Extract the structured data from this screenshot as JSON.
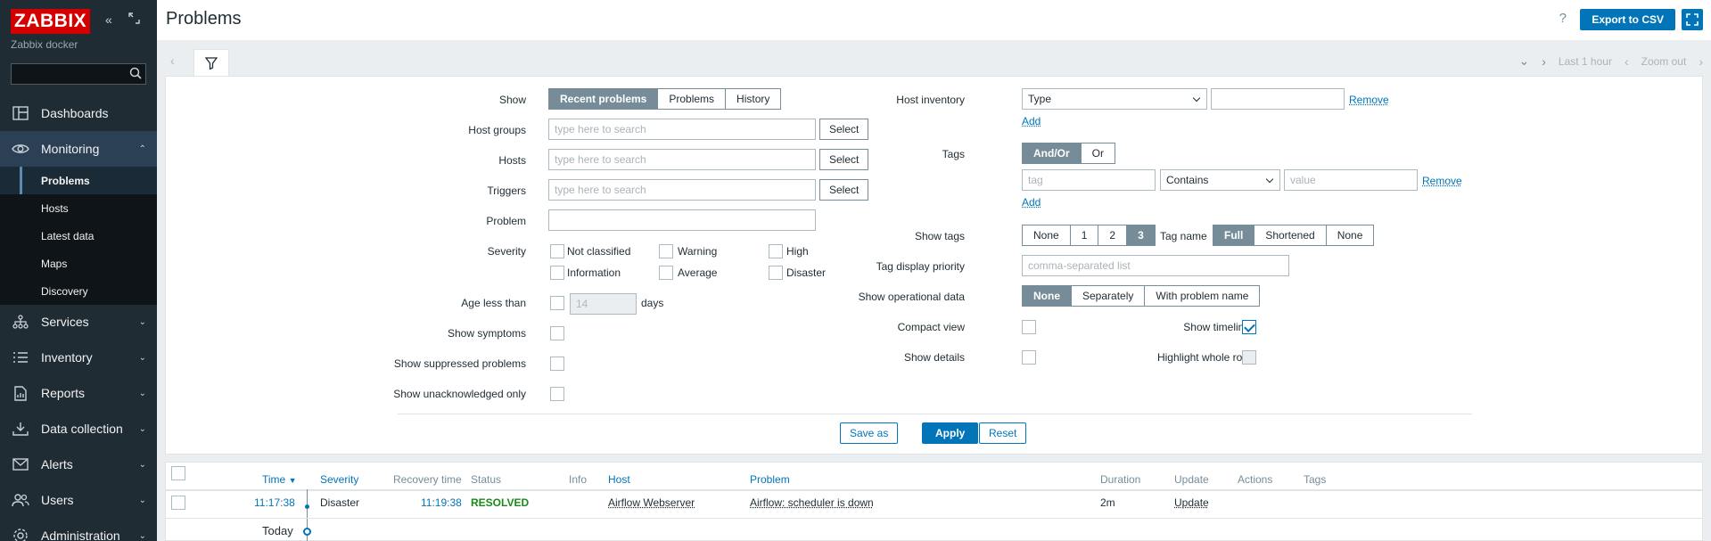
{
  "sidebar": {
    "logo": "ZABBIX",
    "subtitle": "Zabbix docker",
    "search_placeholder": "",
    "nav": [
      {
        "label": "Dashboards",
        "icon": "dashboards-icon"
      },
      {
        "label": "Monitoring",
        "icon": "eye-icon"
      },
      {
        "label": "Services",
        "icon": "services-icon"
      },
      {
        "label": "Inventory",
        "icon": "list-icon"
      },
      {
        "label": "Reports",
        "icon": "reports-icon"
      },
      {
        "label": "Data collection",
        "icon": "download-icon"
      },
      {
        "label": "Alerts",
        "icon": "mail-icon"
      },
      {
        "label": "Users",
        "icon": "users-icon"
      },
      {
        "label": "Administration",
        "icon": "gear-icon"
      }
    ],
    "monitoring_sub": [
      {
        "label": "Problems"
      },
      {
        "label": "Hosts"
      },
      {
        "label": "Latest data"
      },
      {
        "label": "Maps"
      },
      {
        "label": "Discovery"
      }
    ]
  },
  "header": {
    "title": "Problems",
    "help": "?",
    "export": "Export to CSV"
  },
  "timenav": {
    "range": "Last 1 hour",
    "zoom_out": "Zoom out"
  },
  "filter": {
    "show": {
      "label": "Show",
      "options": [
        "Recent problems",
        "Problems",
        "History"
      ],
      "selected": "Recent problems"
    },
    "host_groups": {
      "label": "Host groups",
      "placeholder": "type here to search",
      "button": "Select"
    },
    "hosts": {
      "label": "Hosts",
      "placeholder": "type here to search",
      "button": "Select"
    },
    "triggers": {
      "label": "Triggers",
      "placeholder": "type here to search",
      "button": "Select"
    },
    "problem": {
      "label": "Problem",
      "value": ""
    },
    "severity": {
      "label": "Severity",
      "options": [
        "Not classified",
        "Warning",
        "High",
        "Information",
        "Average",
        "Disaster"
      ]
    },
    "age": {
      "label": "Age less than",
      "value": "14",
      "unit": "days"
    },
    "show_symptoms": {
      "label": "Show symptoms"
    },
    "show_suppressed": {
      "label": "Show suppressed problems"
    },
    "show_unack": {
      "label": "Show unacknowledged only"
    },
    "host_inventory": {
      "label": "Host inventory",
      "select": "Type",
      "value": "",
      "remove": "Remove",
      "add": "Add"
    },
    "tags": {
      "label": "Tags",
      "options": [
        "And/Or",
        "Or"
      ],
      "selected": "And/Or",
      "tag_placeholder": "tag",
      "operator": "Contains",
      "value_placeholder": "value",
      "remove": "Remove",
      "add": "Add"
    },
    "show_tags": {
      "label": "Show tags",
      "options": [
        "None",
        "1",
        "2",
        "3"
      ],
      "selected": "3"
    },
    "tag_name": {
      "label": "Tag name",
      "options": [
        "Full",
        "Shortened",
        "None"
      ],
      "selected": "Full"
    },
    "tag_priority": {
      "label": "Tag display priority",
      "placeholder": "comma-separated list"
    },
    "show_opdata": {
      "label": "Show operational data",
      "options": [
        "None",
        "Separately",
        "With problem name"
      ],
      "selected": "None"
    },
    "compact_view": {
      "label": "Compact view"
    },
    "show_timeline": {
      "label": "Show timeline",
      "checked": true
    },
    "show_details": {
      "label": "Show details"
    },
    "highlight_row": {
      "label": "Highlight whole row"
    },
    "buttons": {
      "save_as": "Save as",
      "apply": "Apply",
      "reset": "Reset"
    }
  },
  "table": {
    "columns": [
      "Time",
      "Severity",
      "Recovery time",
      "Status",
      "Info",
      "Host",
      "Problem",
      "Duration",
      "Update",
      "Actions",
      "Tags"
    ],
    "rows": [
      {
        "time": "11:17:38",
        "severity": "Disaster",
        "recovery": "11:19:38",
        "status": "RESOLVED",
        "info": "",
        "host": "Airflow Webserver",
        "problem": "Airflow: scheduler is down",
        "duration": "2m",
        "update": "Update",
        "actions": "",
        "tags": ""
      }
    ],
    "today": "Today"
  },
  "colors": {
    "accent": "#0275b8",
    "sidebar": "#1f2c33",
    "logo": "#d40000",
    "resolved": "#1a8a1a"
  }
}
